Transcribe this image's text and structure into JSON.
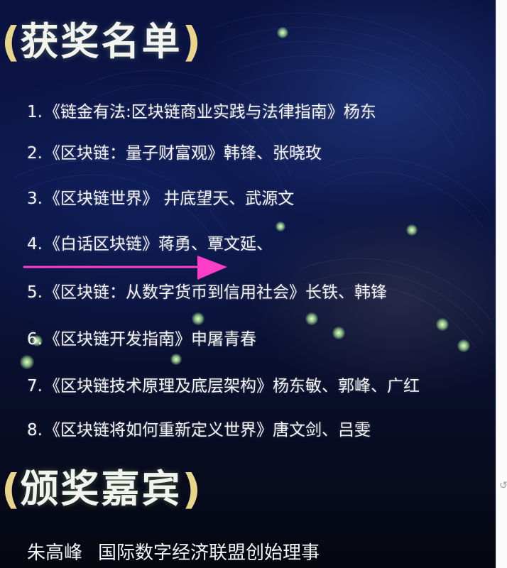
{
  "awards_title": "获奖名单",
  "paren_open": "(",
  "paren_close": ")",
  "awards": [
    {
      "num": "1.",
      "text": "《链金有法:区块链商业实践与法律指南》杨东"
    },
    {
      "num": "2.",
      "text": "《区块链：量子财富观》韩锋、张晓玫"
    },
    {
      "num": "3.",
      "text": "《区块链世界》 井底望天、武源文"
    },
    {
      "num": "4.",
      "text": "《白话区块链》蒋勇、覃文延、"
    },
    {
      "num": "5.",
      "text": "《区块链：从数字货币到信用社会》长铁、韩锋"
    },
    {
      "num": "6.",
      "text": "《区块链开发指南》申屠青春"
    },
    {
      "num": "7.",
      "text": "《区块链技术原理及底层架构》杨东敏、郭峰、广红"
    },
    {
      "num": "8.",
      "text": "《区块链将如何重新定义世界》唐文剑、吕雯"
    }
  ],
  "presenters_title": "颁奖嘉宾",
  "presenter": {
    "name": "朱高峰",
    "role": "国际数字经济联盟创始理事"
  },
  "colors": {
    "background": "#0a1240",
    "title_paren": "#e9d58a",
    "text": "#f4f4f4",
    "arrow": "#ff3ec8",
    "glow": "#c8f5a0"
  }
}
